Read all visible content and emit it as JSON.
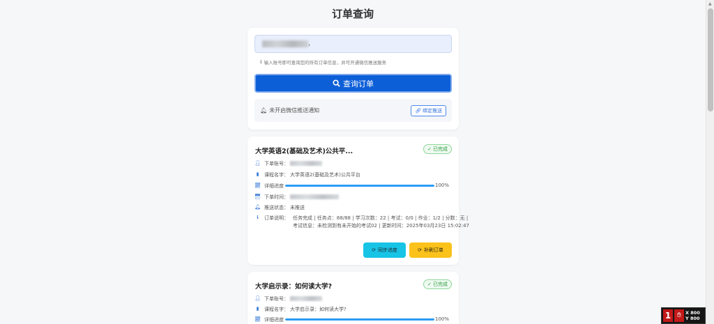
{
  "page": {
    "title": "订单查询"
  },
  "search": {
    "input_suffix": ",",
    "hint": "输入账号即可查询您的所有订单信息，并可开通微信推送服务",
    "query_label": "查询订单",
    "push_status": "未开启微信推送通知",
    "bind_label": "绑定推送"
  },
  "labels": {
    "account": "下单账号：",
    "course": "课程名字：",
    "progress": "详细进度",
    "time": "下单时间：",
    "push": "推送状态：",
    "desc": "订单说明："
  },
  "orders": [
    {
      "title": "大学英语2(基础及艺术)公共平...",
      "status": "已完成",
      "course": "大学英语2(基础及艺术)公共平台",
      "progress": 1.0,
      "progress_text": "100%",
      "push_status": "未推送",
      "description": "任务完成 | 任务点：88/88 | 学习次数：22 | 考试：0/0 | 作业：1/2 | 分数：无 | 考试信息：未检测到有未开始的考试02 | 更新时间：2025年03月23日 15:02:47",
      "sync_label": "同步进度",
      "refill_label": "补刷订单"
    },
    {
      "title": "大学启示录：如何读大学?",
      "status": "已完成",
      "course": "大学启示录：如何读大学?",
      "progress": 1.0,
      "progress_text": "100%"
    }
  ],
  "overlay": {
    "number": "1",
    "x_text": "X 800",
    "y_text": "Y 800"
  }
}
